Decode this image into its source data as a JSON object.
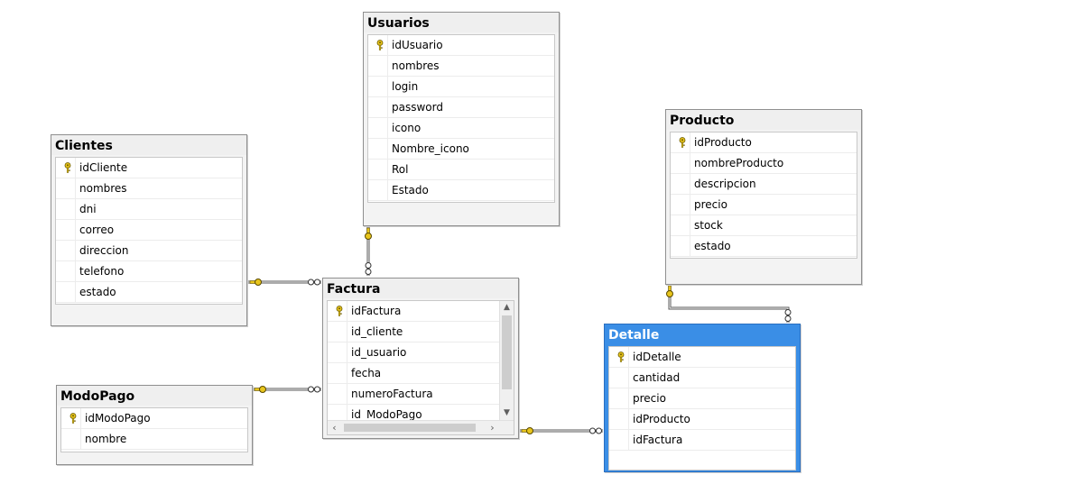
{
  "colors": {
    "selected_title_bg": "#3a8ee6",
    "key_icon": "#e8c51c",
    "relationship_line": "#5a5a5a"
  },
  "tables": {
    "usuarios": {
      "title": "Usuarios",
      "columns": [
        "idUsuario",
        "nombres",
        "login",
        "password",
        "icono",
        "Nombre_icono",
        "Rol",
        "Estado"
      ],
      "pk": "idUsuario"
    },
    "clientes": {
      "title": "Clientes",
      "columns": [
        "idCliente",
        "nombres",
        "dni",
        "correo",
        "direccion",
        "telefono",
        "estado"
      ],
      "pk": "idCliente"
    },
    "producto": {
      "title": "Producto",
      "columns": [
        "idProducto",
        "nombreProducto",
        "descripcion",
        "precio",
        "stock",
        "estado"
      ],
      "pk": "idProducto"
    },
    "factura": {
      "title": "Factura",
      "columns": [
        "idFactura",
        "id_cliente",
        "id_usuario",
        "fecha",
        "numeroFactura",
        "id_ModoPago"
      ],
      "pk": "idFactura"
    },
    "modopago": {
      "title": "ModoPago",
      "columns": [
        "idModoPago",
        "nombre"
      ],
      "pk": "idModoPago"
    },
    "detalle": {
      "title": "Detalle",
      "columns": [
        "idDetalle",
        "cantidad",
        "precio",
        "idProducto",
        "idFactura"
      ],
      "pk": "idDetalle",
      "selected": true
    }
  },
  "icons": {
    "primary_key": "key-icon",
    "one_end": "key-connector-icon",
    "many_end": "infinity-icon",
    "scroll_up": "scroll-up-arrow-icon",
    "scroll_down": "scroll-down-arrow-icon",
    "scroll_left": "scroll-left-arrow-icon",
    "scroll_right": "scroll-right-arrow-icon"
  },
  "relationships": [
    {
      "from": "usuarios",
      "to": "factura"
    },
    {
      "from": "clientes",
      "to": "factura"
    },
    {
      "from": "modopago",
      "to": "factura"
    },
    {
      "from": "factura",
      "to": "detalle"
    },
    {
      "from": "producto",
      "to": "detalle"
    }
  ]
}
